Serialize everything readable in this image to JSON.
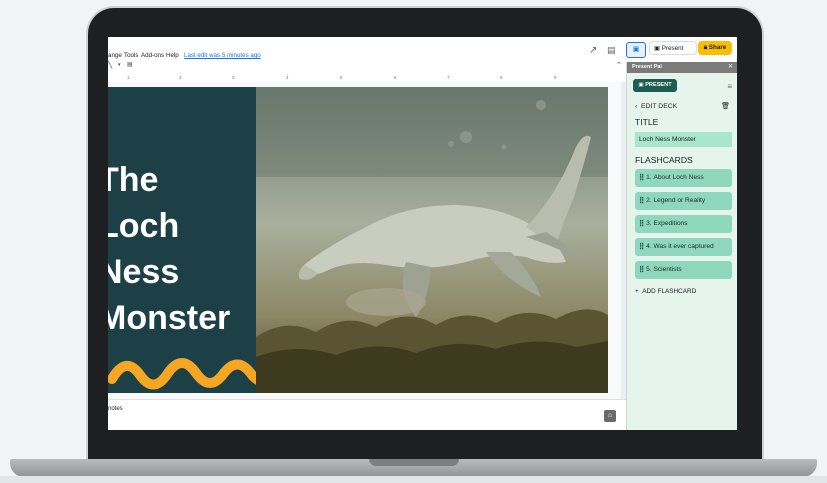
{
  "menu": {
    "items": [
      "ange",
      "Tools",
      "Add-ons",
      "Help"
    ],
    "last_edit": "Last edit was 5 minutes ago"
  },
  "toolbar": {
    "present_label": "Present",
    "share_label": "Share",
    "ruler_ticks": [
      "1",
      "2",
      "3",
      "4",
      "5",
      "6",
      "7",
      "8",
      "9"
    ]
  },
  "slide": {
    "title": "The\nLoch\nNess\nMonster"
  },
  "notes": {
    "label": "notes"
  },
  "panel": {
    "header_title": "Present Pal",
    "present_button": "PRESENT",
    "edit_deck": "EDIT DECK",
    "title_section": "TITLE",
    "title_value": "Loch Ness Monster",
    "flashcards_section": "FLASHCARDS",
    "cards": [
      "1. About Loch Ness",
      "2. Legend or Reality",
      "3. Expeditions",
      "4. Was it ever captured",
      "5. Scientists"
    ],
    "add_flashcard": "ADD FLASHCARD"
  },
  "colors": {
    "slide_dark": "#1d3f46",
    "accent_yellow": "#fbbc04",
    "panel_bg": "#e5f5ee",
    "card_bg": "#8fd7bf",
    "present_btn": "#1c5c52"
  }
}
